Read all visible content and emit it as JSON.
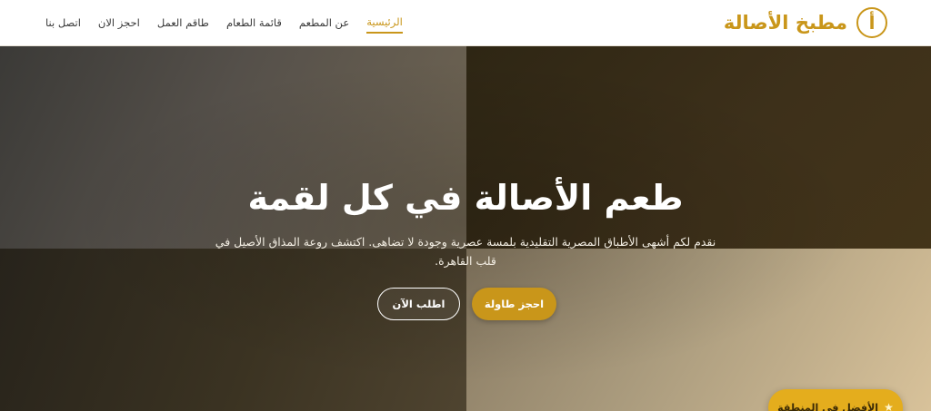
{
  "brand": {
    "logo_letter": "أ",
    "name": "مطبخ الأصالة"
  },
  "nav": {
    "items": [
      {
        "label": "الرئيسية",
        "active": true
      },
      {
        "label": "عن المطعم",
        "active": false
      },
      {
        "label": "قائمة الطعام",
        "active": false
      },
      {
        "label": "طاقم العمل",
        "active": false
      },
      {
        "label": "احجز الان",
        "active": false
      },
      {
        "label": "اتصل بنا",
        "active": false
      }
    ]
  },
  "hero": {
    "title": "طعم الأصالة في كل لقمة",
    "subtitle": "نقدم لكم أشهى الأطباق المصرية التقليدية بلمسة عصرية وجودة لا تضاهى. اكتشف روعة المذاق الأصيل في قلب القاهرة.",
    "primary_button": "احجز طاولة",
    "secondary_button": "اطلب الآن"
  },
  "badge": {
    "icon": "star-icon",
    "label": "الأفضل في المنطقة"
  },
  "colors": {
    "accent": "#c9961a",
    "badge": "#e4ad1d",
    "header_bg": "#ffffff"
  }
}
